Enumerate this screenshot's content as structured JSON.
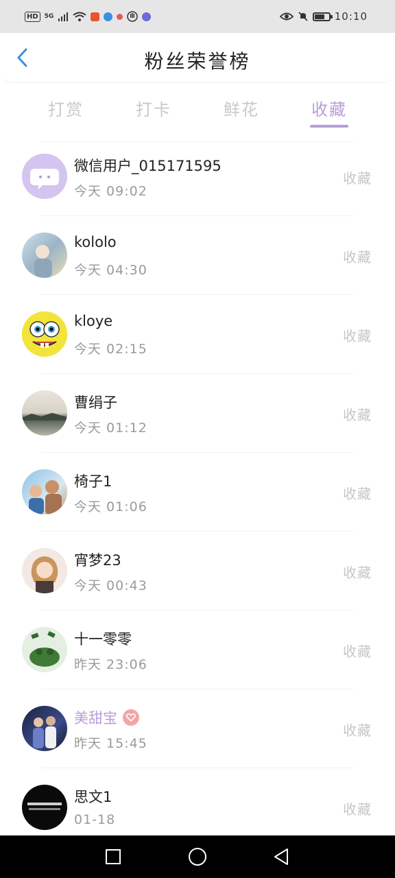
{
  "status_bar": {
    "time": "10:10",
    "hd_label": "HD",
    "signal_label": "5G",
    "battery_level": 0.75,
    "icons": [
      "hd-icon",
      "5g-signal-icon",
      "wifi-icon",
      "taobao-icon",
      "browser-icon",
      "app-icon",
      "hand-icon",
      "music-icon",
      "eye-icon",
      "mute-bell-icon",
      "battery-icon"
    ]
  },
  "header": {
    "title": "粉丝荣誉榜",
    "back_icon": "chevron-left-icon"
  },
  "tabs": [
    {
      "label": "打赏",
      "active": false
    },
    {
      "label": "打卡",
      "active": false
    },
    {
      "label": "鲜花",
      "active": false
    },
    {
      "label": "收藏",
      "active": true
    }
  ],
  "list": [
    {
      "name": "微信用户_015171595",
      "time": "今天 09:02",
      "action": "收藏",
      "avatar": "wechat-default-avatar"
    },
    {
      "name": "kololo",
      "time": "今天 04:30",
      "action": "收藏",
      "avatar": "photo-avatar"
    },
    {
      "name": "kloye",
      "time": "今天 02:15",
      "action": "收藏",
      "avatar": "spongebob-avatar"
    },
    {
      "name": "曹绢子",
      "time": "今天 01:12",
      "action": "收藏",
      "avatar": "landscape-avatar"
    },
    {
      "name": "椅子1",
      "time": "今天 01:06",
      "action": "收藏",
      "avatar": "people-avatar"
    },
    {
      "name": "宵梦23",
      "time": "今天 00:43",
      "action": "收藏",
      "avatar": "anime-avatar"
    },
    {
      "name": "十一零零",
      "time": "昨天 23:06",
      "action": "收藏",
      "avatar": "frog-avatar"
    },
    {
      "name": "美甜宝",
      "time": "昨天 15:45",
      "action": "收藏",
      "avatar": "couple-avatar",
      "vip": true,
      "badge": "heart-icon"
    },
    {
      "name": "思文1",
      "time": "01-18",
      "action": "收藏",
      "avatar": "dark-text-avatar"
    }
  ],
  "colors": {
    "accent": "#b79ed8",
    "tab_inactive": "#c9c9c9",
    "action_text": "#c6c6c6",
    "time_text": "#9a9a9a",
    "back_arrow": "#3d8fe0"
  },
  "nav_bar": {
    "icons": [
      "recent-apps-icon",
      "home-icon",
      "back-icon"
    ]
  }
}
